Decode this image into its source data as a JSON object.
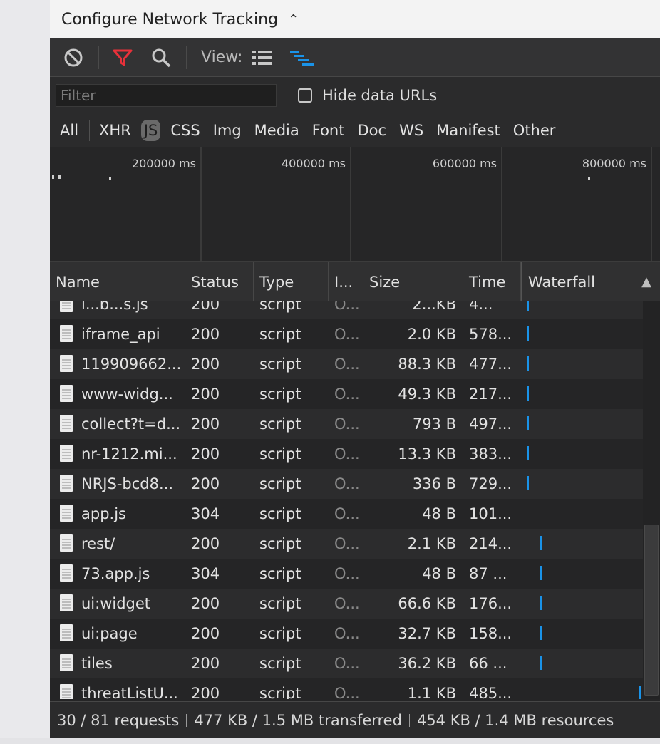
{
  "configure": {
    "title": "Configure Network Tracking",
    "chevron": "⌃"
  },
  "toolbar": {
    "view_label": "View:",
    "icons": [
      "clear-icon",
      "filter-icon",
      "search-icon",
      "list-view-icon",
      "waterfall-view-icon"
    ]
  },
  "filter": {
    "placeholder": "Filter",
    "value": "",
    "hide_data_urls_label": "Hide data URLs",
    "hide_data_urls_checked": false
  },
  "types": {
    "items": [
      "All",
      "XHR",
      "JS",
      "CSS",
      "Img",
      "Media",
      "Font",
      "Doc",
      "WS",
      "Manifest",
      "Other"
    ],
    "active": "JS"
  },
  "overview": {
    "ticks": [
      "200000 ms",
      "400000 ms",
      "600000 ms",
      "800000 ms"
    ]
  },
  "table": {
    "headers": {
      "name": "Name",
      "status": "Status",
      "type": "Type",
      "initiator": "I...",
      "size": "Size",
      "time": "Time",
      "waterfall": "Waterfall"
    },
    "rows": [
      {
        "name": "i...b...s.js",
        "status": "200",
        "type": "script",
        "initiator": "O...",
        "size": "2...KB",
        "time": "4...",
        "waterfall_offset": 0.0
      },
      {
        "name": "iframe_api",
        "status": "200",
        "type": "script",
        "initiator": "O...",
        "size": "2.0 KB",
        "time": "578...",
        "waterfall_offset": 0.0
      },
      {
        "name": "119909662...",
        "status": "200",
        "type": "script",
        "initiator": "O...",
        "size": "88.3 KB",
        "time": "477...",
        "waterfall_offset": 0.0
      },
      {
        "name": "www-widg...",
        "status": "200",
        "type": "script",
        "initiator": "O...",
        "size": "49.3 KB",
        "time": "217...",
        "waterfall_offset": 0.0
      },
      {
        "name": "collect?t=d...",
        "status": "200",
        "type": "script",
        "initiator": "O...",
        "size": "793 B",
        "time": "497...",
        "waterfall_offset": 0.0
      },
      {
        "name": "nr-1212.mi...",
        "status": "200",
        "type": "script",
        "initiator": "O...",
        "size": "13.3 KB",
        "time": "383...",
        "waterfall_offset": 0.0
      },
      {
        "name": "NRJS-bcd8...",
        "status": "200",
        "type": "script",
        "initiator": "O...",
        "size": "336 B",
        "time": "729...",
        "waterfall_offset": 0.0
      },
      {
        "name": "app.js",
        "status": "304",
        "type": "script",
        "initiator": "O...",
        "size": "48 B",
        "time": "101...",
        "waterfall_offset": null
      },
      {
        "name": "rest/",
        "status": "200",
        "type": "script",
        "initiator": "O...",
        "size": "2.1 KB",
        "time": "214...",
        "waterfall_offset": 0.12
      },
      {
        "name": "73.app.js",
        "status": "304",
        "type": "script",
        "initiator": "O...",
        "size": "48 B",
        "time": "87 ...",
        "waterfall_offset": 0.12
      },
      {
        "name": "ui:widget",
        "status": "200",
        "type": "script",
        "initiator": "O...",
        "size": "66.6 KB",
        "time": "176...",
        "waterfall_offset": 0.12
      },
      {
        "name": "ui:page",
        "status": "200",
        "type": "script",
        "initiator": "O...",
        "size": "32.7 KB",
        "time": "158...",
        "waterfall_offset": 0.12
      },
      {
        "name": "tiles",
        "status": "200",
        "type": "script",
        "initiator": "O...",
        "size": "36.2 KB",
        "time": "66 ...",
        "waterfall_offset": 0.12
      },
      {
        "name": "threatListU...",
        "status": "200",
        "type": "script",
        "initiator": "O...",
        "size": "1.1 KB",
        "time": "485...",
        "waterfall_offset": 0.98
      }
    ]
  },
  "status_bar": {
    "requests": "30 / 81 requests",
    "transferred": "477 KB / 1.5 MB transferred",
    "resources": "454 KB / 1.4 MB resources"
  },
  "colors": {
    "accent_blue": "#1a93e8",
    "filter_active_red": "#e8313a",
    "panel_bg": "#252526"
  }
}
